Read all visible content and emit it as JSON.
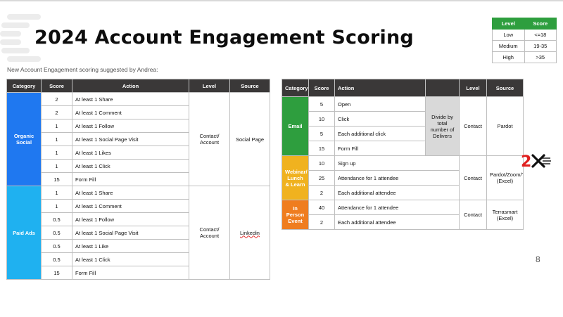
{
  "title": "2024 Account Engagement Scoring",
  "subtitle": "New Account Engagement scoring suggested by Andrea:",
  "page_number": "8",
  "legend": {
    "headers": [
      "Level",
      "Score"
    ],
    "rows": [
      [
        "Low",
        "<=18"
      ],
      [
        "Medium",
        "19-35"
      ],
      [
        "High",
        ">35"
      ]
    ]
  },
  "left_table": {
    "headers": [
      "Category",
      "Score",
      "Action",
      "Level",
      "Source"
    ],
    "groups": [
      {
        "category": "Organic Social",
        "level": "Contact/ Account",
        "source": "Social Page",
        "rows": [
          [
            "2",
            "At least 1 Share"
          ],
          [
            "2",
            "At least 1 Comment"
          ],
          [
            "1",
            "At least 1 Follow"
          ],
          [
            "1",
            "At least 1 Social Page Visit"
          ],
          [
            "1",
            "At least 1 Likes"
          ],
          [
            "1",
            "At least 1 Click"
          ],
          [
            "15",
            "Form Fill"
          ]
        ]
      },
      {
        "category": "Paid Ads",
        "level": "Contact/ Account",
        "source": "Linkedin",
        "rows": [
          [
            "1",
            "At least 1 Share"
          ],
          [
            "1",
            "At least 1 Comment"
          ],
          [
            "0.5",
            "At least 1 Follow"
          ],
          [
            "0.5",
            "At least 1 Social Page Visit"
          ],
          [
            "0.5",
            "At least 1 Like"
          ],
          [
            "0.5",
            "At least 1 Click"
          ],
          [
            "15",
            "Form Fill"
          ]
        ]
      }
    ]
  },
  "right_table": {
    "headers": [
      "Category",
      "Score",
      "Action",
      "",
      "Level",
      "Source"
    ],
    "groups": [
      {
        "category": "Email",
        "note": "Divide by total number of Delivers",
        "level": "Contact",
        "source": "Pardot",
        "rows": [
          [
            "5",
            "Open"
          ],
          [
            "10",
            "Click"
          ],
          [
            "5",
            "Each additional click"
          ],
          [
            "15",
            "Form Fill"
          ]
        ]
      },
      {
        "category": "Webinar/ Lunch & Learn",
        "level": "Contact",
        "source": "Pardot/Zoom/Terrasmart (Excel)",
        "rows": [
          [
            "10",
            "Sign up"
          ],
          [
            "25",
            "Attendance for 1 attendee"
          ],
          [
            "2",
            "Each additional attendee"
          ]
        ]
      },
      {
        "category": "In Person Event",
        "level": "Contact",
        "source": "Terrasmart (Excel)",
        "rows": [
          [
            "40",
            "Attendance for 1 attendee"
          ],
          [
            "2",
            "Each additional attendee"
          ]
        ]
      }
    ]
  },
  "colors": {
    "organic": "#1f78f0",
    "paid": "#1fb1f0",
    "email": "#2e9e3e",
    "webinar": "#f0b21f",
    "in_person": "#ef7d1f",
    "header_dark": "#3a3838",
    "legend_header": "#2e9e3e"
  },
  "icons": [
    "speed-lines-decoration-icon",
    "company-logo-2x-icon"
  ]
}
